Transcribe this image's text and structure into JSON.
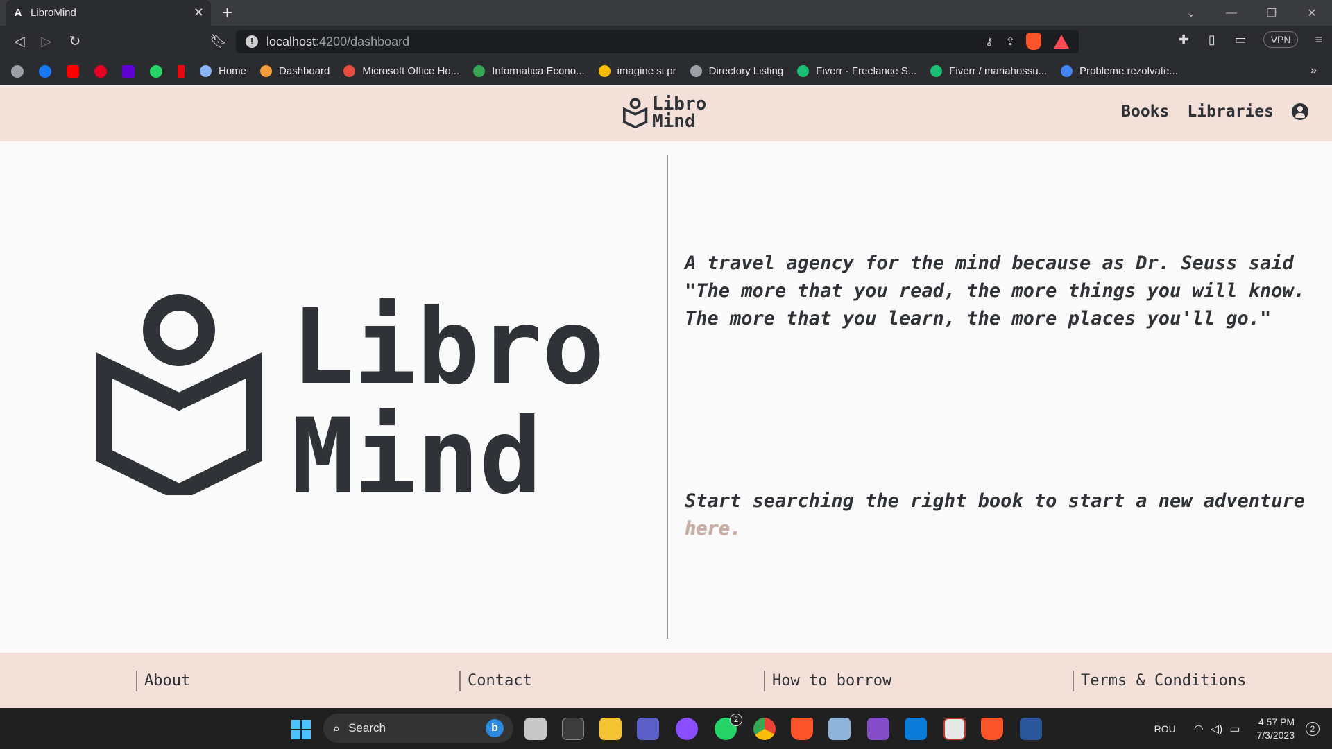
{
  "browser": {
    "tab_title": "LibroMind",
    "tab_favicon": "A",
    "new_tab": "+",
    "url_host": "localhost",
    "url_path": ":4200/dashboard",
    "vpn_label": "VPN",
    "bookmarks": [
      {
        "label": "Home",
        "color": "#8ab4f8"
      },
      {
        "label": "Dashboard",
        "color": "#f29d38"
      },
      {
        "label": "Microsoft Office Ho...",
        "color": "#e74c3c"
      },
      {
        "label": "Informatica Econo...",
        "color": "#34a853"
      },
      {
        "label": "imagine si pr",
        "color": "#fbbc05"
      },
      {
        "label": "Directory Listing",
        "color": "#9aa0a6"
      },
      {
        "label": "Fiverr - Freelance S...",
        "color": "#1dbf73"
      },
      {
        "label": "Fiverr / mariahossu...",
        "color": "#1dbf73"
      },
      {
        "label": "Probleme rezolvate...",
        "color": "#4285f4"
      }
    ],
    "bookmark_more": "»"
  },
  "header": {
    "logo_line1": "Libro",
    "logo_line2": "Mind",
    "nav_books": "Books",
    "nav_libraries": "Libraries"
  },
  "hero": {
    "line1": "Libro",
    "line2": "Mind"
  },
  "content": {
    "quote": "A travel agency for the mind because as Dr. Seuss said \"The more that you read, the more things you will know. The more that you learn, the more places you'll go.\"",
    "cta_text": "Start searching the right book to start a new adventure ",
    "cta_link": "here."
  },
  "footer": {
    "about": "About",
    "contact": "Contact",
    "how_to_borrow": "How to borrow",
    "terms": "Terms & Conditions"
  },
  "taskbar": {
    "search_label": "Search",
    "whatsapp_badge": "2",
    "lang": "ROU",
    "time": "4:57 PM",
    "date": "7/3/2023",
    "notifications": "2"
  },
  "colors": {
    "header_bg": "#f2e0d9",
    "text_dark": "#2f3236",
    "link_here": "#c8aea4"
  }
}
